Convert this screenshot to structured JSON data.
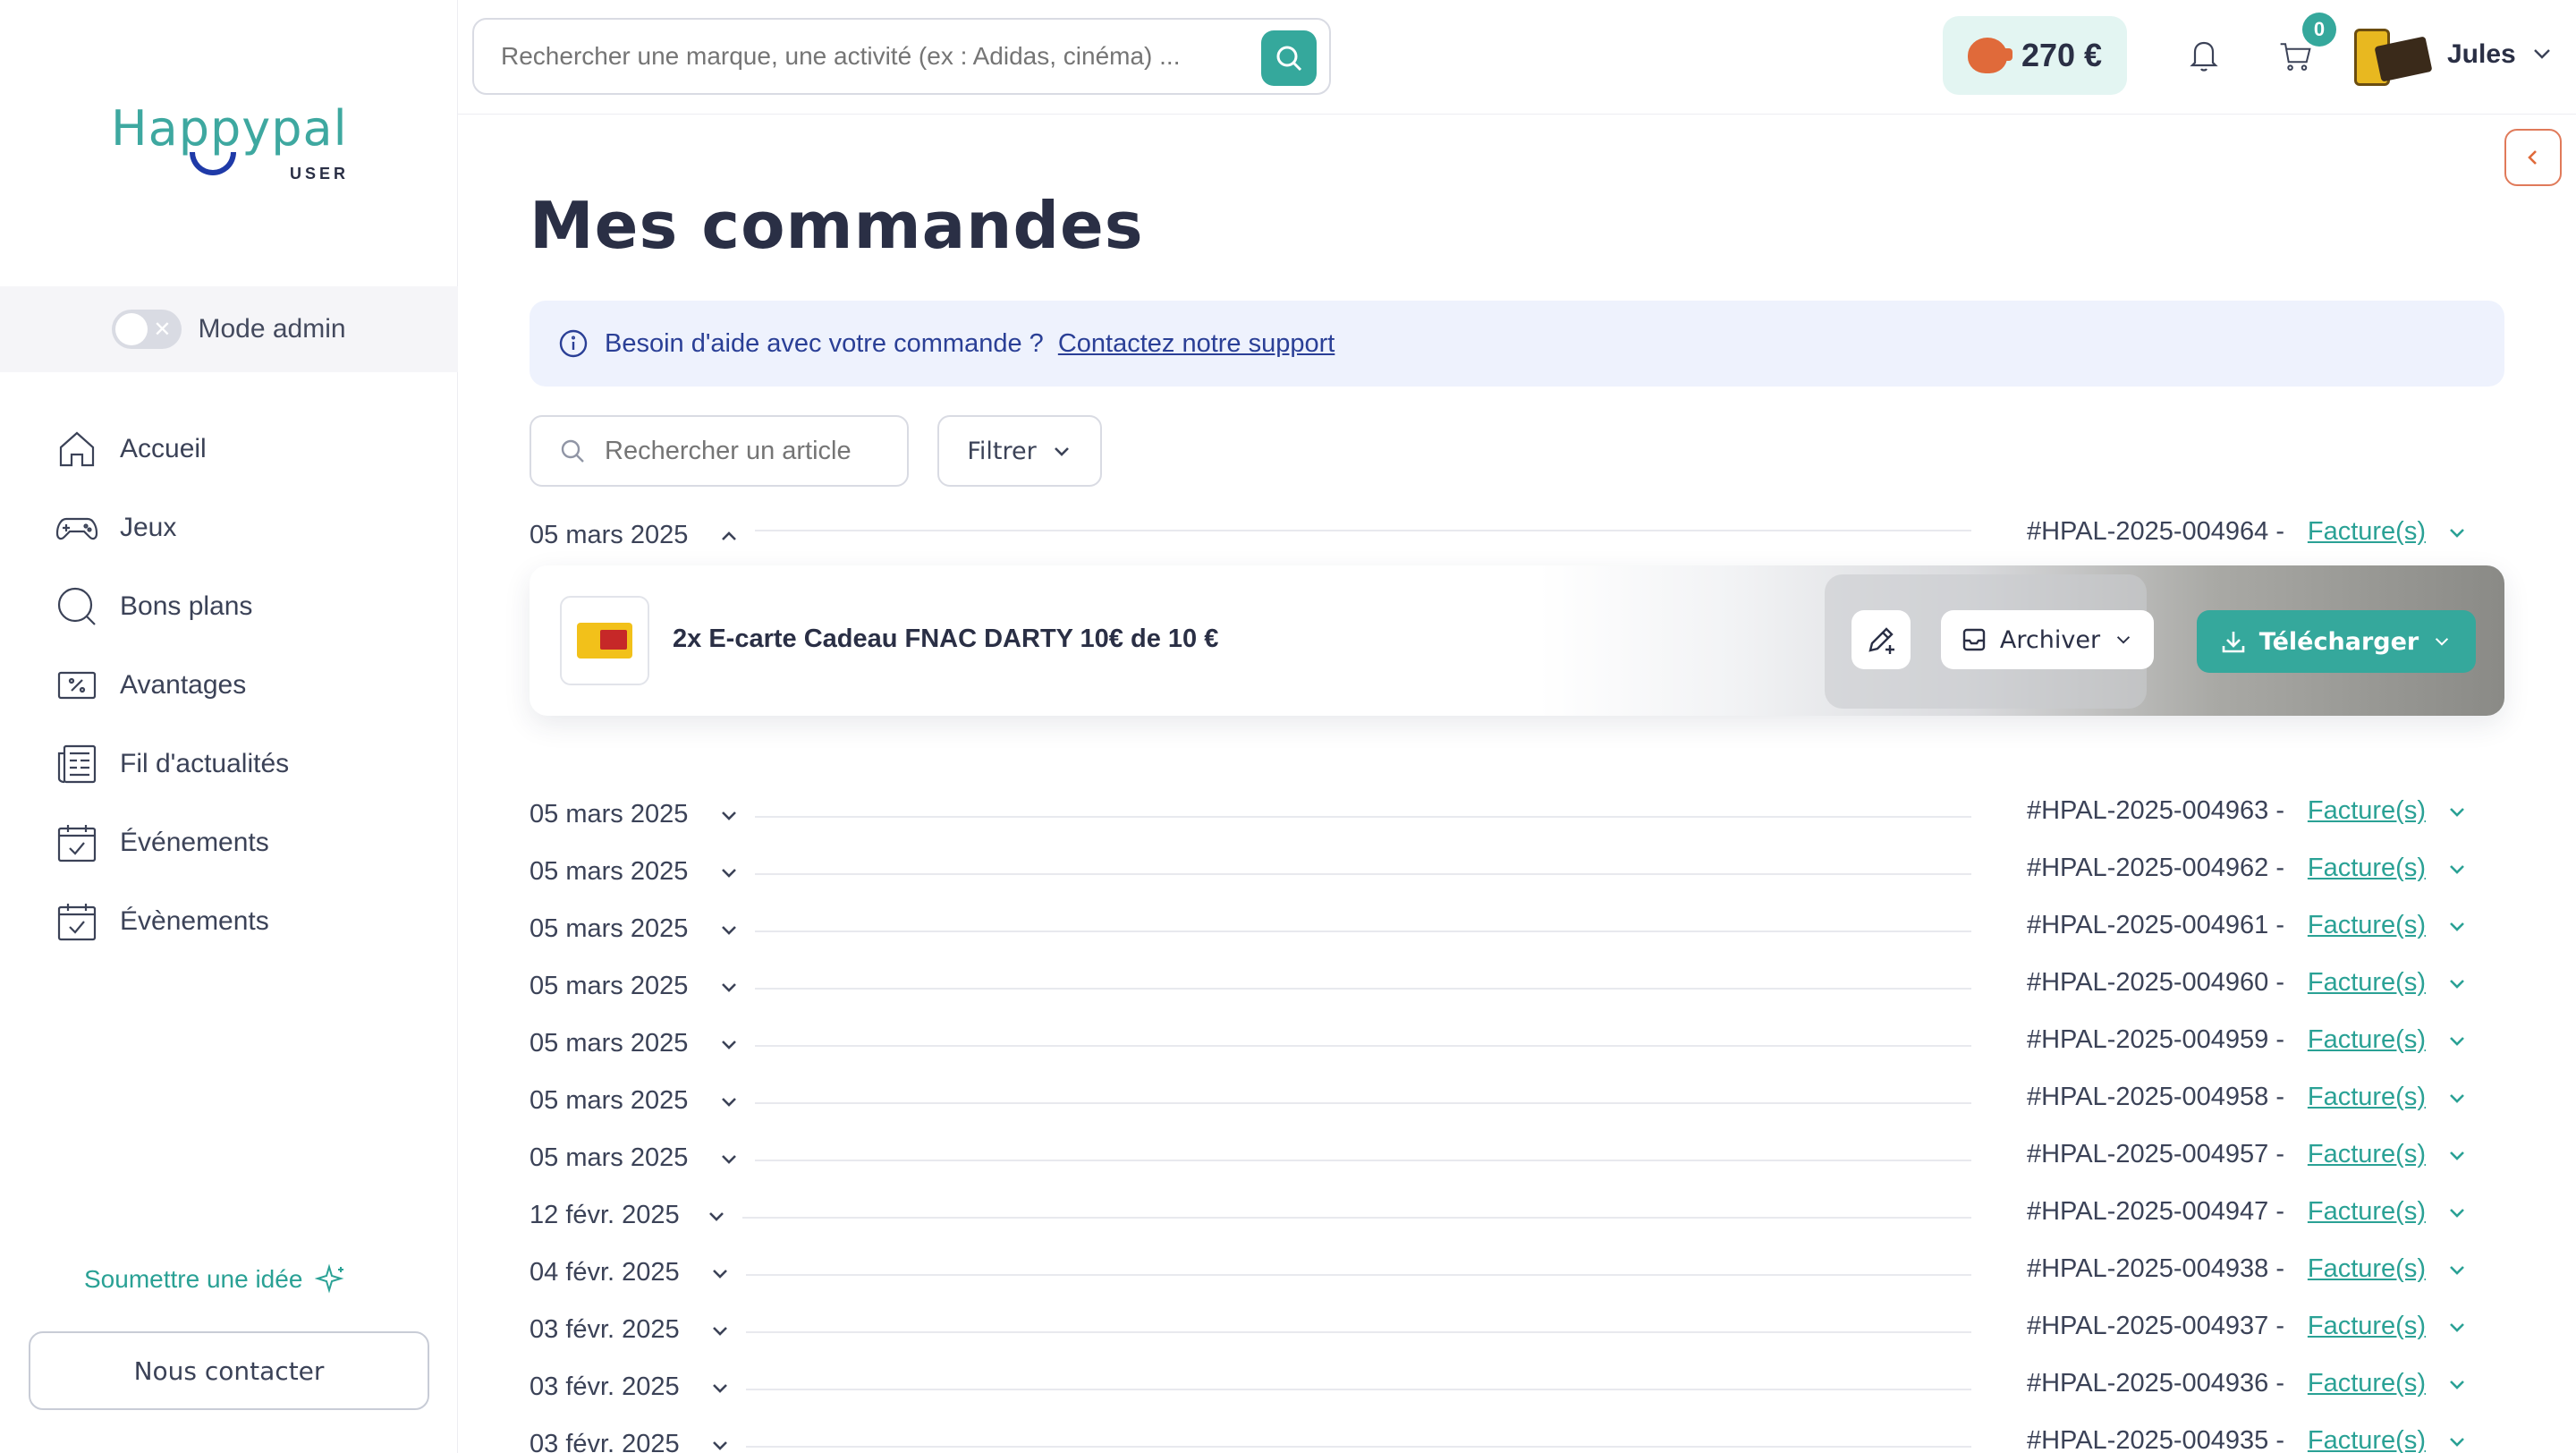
{
  "brand": {
    "name": "Happypal",
    "sub": "USER",
    "accent": "#35a89c"
  },
  "sidebar": {
    "admin_label": "Mode admin",
    "items": [
      {
        "label": "Accueil",
        "icon": "home-icon"
      },
      {
        "label": "Jeux",
        "icon": "gamepad-icon"
      },
      {
        "label": "Bons plans",
        "icon": "search-circle-icon"
      },
      {
        "label": "Avantages",
        "icon": "percent-icon"
      },
      {
        "label": "Fil d'actualités",
        "icon": "newspaper-icon"
      },
      {
        "label": "Événements",
        "icon": "calendar-check-icon"
      },
      {
        "label": "Évènements",
        "icon": "calendar-check-icon"
      }
    ],
    "idea_label": "Soumettre une idée",
    "contact_label": "Nous contacter"
  },
  "topbar": {
    "search_placeholder": "Rechercher une marque, une activité (ex : Adidas, cinéma) ...",
    "balance": "270 €",
    "cart_count": "0",
    "user_name": "Jules"
  },
  "main": {
    "title": "Mes commandes",
    "help_text": "Besoin d'aide avec votre commande ?",
    "help_link": "Contactez notre support",
    "search_placeholder": "Rechercher un article",
    "filter_label": "Filtrer",
    "expanded_product": {
      "title": "2x E-carte Cadeau FNAC DARTY 10€ de 10 €",
      "archive_label": "Archiver",
      "download_label": "Télécharger"
    },
    "orders": [
      {
        "date": "05 mars 2025",
        "ref": "#HPAL-2025-004964 -",
        "invoice": "Facture(s)",
        "expanded": true
      },
      {
        "date": "05 mars 2025",
        "ref": "#HPAL-2025-004963 -",
        "invoice": "Facture(s)"
      },
      {
        "date": "05 mars 2025",
        "ref": "#HPAL-2025-004962 -",
        "invoice": "Facture(s)"
      },
      {
        "date": "05 mars 2025",
        "ref": "#HPAL-2025-004961 -",
        "invoice": "Facture(s)"
      },
      {
        "date": "05 mars 2025",
        "ref": "#HPAL-2025-004960 -",
        "invoice": "Facture(s)"
      },
      {
        "date": "05 mars 2025",
        "ref": "#HPAL-2025-004959 -",
        "invoice": "Facture(s)"
      },
      {
        "date": "05 mars 2025",
        "ref": "#HPAL-2025-004958 -",
        "invoice": "Facture(s)"
      },
      {
        "date": "05 mars 2025",
        "ref": "#HPAL-2025-004957 -",
        "invoice": "Facture(s)"
      },
      {
        "date": "12 févr. 2025",
        "ref": "#HPAL-2025-004947 -",
        "invoice": "Facture(s)"
      },
      {
        "date": "04 févr. 2025",
        "ref": "#HPAL-2025-004938 -",
        "invoice": "Facture(s)"
      },
      {
        "date": "03 févr. 2025",
        "ref": "#HPAL-2025-004937 -",
        "invoice": "Facture(s)"
      },
      {
        "date": "03 févr. 2025",
        "ref": "#HPAL-2025-004936 -",
        "invoice": "Facture(s)"
      },
      {
        "date": "03 févr. 2025",
        "ref": "#HPAL-2025-004935 -",
        "invoice": "Facture(s)"
      }
    ]
  }
}
